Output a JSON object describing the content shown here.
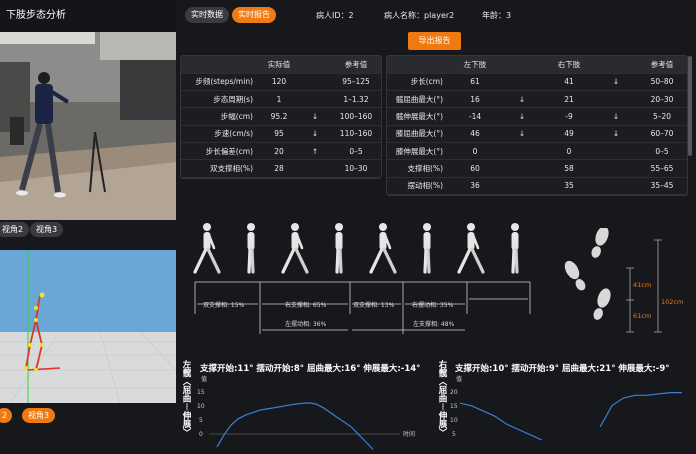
{
  "left": {
    "title": "下肢步态分析",
    "view_labels": [
      "视角2",
      "视角3"
    ],
    "bottom_buttons": [
      "2",
      "视角3"
    ]
  },
  "top": {
    "tab_realtime_data": "实时数据",
    "tab_realtime_report": "实时报告",
    "patient_id_label": "病人ID：",
    "patient_id": "2",
    "patient_name_label": "病人名称：",
    "patient_name": "player2",
    "age_label": "年龄：",
    "age": "3",
    "export_button": "导出报告"
  },
  "table1": {
    "headers": [
      "",
      "实际值",
      "",
      "参考值"
    ],
    "rows": [
      {
        "name": "步频(steps/min)",
        "value": "120",
        "arrow": "",
        "ref": "95–125"
      },
      {
        "name": "步态周期(s)",
        "value": "1",
        "arrow": "",
        "ref": "1–1.32"
      },
      {
        "name": "步幅(cm)",
        "value": "95.2",
        "arrow": "↓",
        "ref": "100–160"
      },
      {
        "name": "步速(cm/s)",
        "value": "95",
        "arrow": "↓",
        "ref": "110–160"
      },
      {
        "name": "步长偏差(cm)",
        "value": "20",
        "arrow": "↑",
        "ref": "0–5"
      },
      {
        "name": "双支撑相(%)",
        "value": "28",
        "arrow": "",
        "ref": "10–30"
      }
    ]
  },
  "table2": {
    "headers": [
      "",
      "左下肢",
      "",
      "右下肢",
      "",
      "参考值"
    ],
    "rows": [
      {
        "name": "步长(cm)",
        "left": "61",
        "la": "",
        "right": "41",
        "ra": "↓",
        "ref": "50–80"
      },
      {
        "name": "髋屈曲最大(°)",
        "left": "16",
        "la": "↓",
        "right": "21",
        "ra": "",
        "ref": "20–30"
      },
      {
        "name": "髋伸展最大(°)",
        "left": "-14",
        "la": "↓",
        "right": "-9",
        "ra": "↓",
        "ref": "5–20"
      },
      {
        "name": "膝屈曲最大(°)",
        "left": "46",
        "la": "↓",
        "right": "49",
        "ra": "↓",
        "ref": "60–70"
      },
      {
        "name": "膝伸展最大(°)",
        "left": "0",
        "la": "",
        "right": "0",
        "ra": "",
        "ref": "0–5"
      },
      {
        "name": "支撑相(%)",
        "left": "60",
        "la": "",
        "right": "58",
        "ra": "",
        "ref": "55–65"
      },
      {
        "name": "摆动相(%)",
        "left": "36",
        "la": "",
        "right": "35",
        "ra": "",
        "ref": "35–45"
      }
    ]
  },
  "gait": {
    "labels_row1": [
      "双支撑相: 15%",
      "右支撑相: 65%",
      "双支撑相: 13%",
      "右摆动相: 35%"
    ],
    "labels_row2": [
      "左摆动相: 36%",
      "左支撑相: 48%"
    ],
    "foot_lengths": [
      "41cm",
      "61cm",
      "102cm"
    ]
  },
  "left_chart": {
    "side_label": "左髋︿屈曲︱伸展﹀",
    "stats": "支撑开始:11°  摆动开始:8°  屈曲最大:16°  伸展最大:-14°",
    "ylabel": "值",
    "xlabel": "时间",
    "yticks": [
      "15",
      "10",
      "5",
      "0"
    ]
  },
  "right_chart": {
    "side_label": "右髋︿屈曲︱伸展﹀",
    "stats": "支撑开始:10°  摆动开始:9°  屈曲最大:21°  伸展最大:-9°",
    "ylabel": "值",
    "yticks": [
      "20",
      "15",
      "10",
      "5"
    ]
  },
  "chart_data": [
    {
      "type": "line",
      "title": "",
      "xlabel": "时间",
      "ylabel": "值",
      "ylim": [
        0,
        18
      ],
      "series": [
        {
          "values": [
            -2,
            3,
            7,
            9.5,
            11,
            12,
            13,
            13.5,
            14,
            14.5,
            15,
            15.5,
            15.8,
            16,
            15.5,
            14,
            12,
            10,
            8,
            6,
            3,
            0,
            -3
          ]
        }
      ]
    },
    {
      "type": "line",
      "title": "",
      "xlabel": "",
      "ylabel": "值",
      "ylim": [
        3,
        22
      ],
      "series": [
        {
          "values": [
            17,
            16,
            14,
            12,
            9,
            7,
            5,
            3,
            null,
            null,
            null,
            null,
            8,
            16,
            19,
            20,
            20,
            20.5,
            21,
            21
          ]
        }
      ]
    }
  ],
  "colors": {
    "accent": "#f07a12",
    "line": "#3b7fd6",
    "background": "#17181c"
  }
}
